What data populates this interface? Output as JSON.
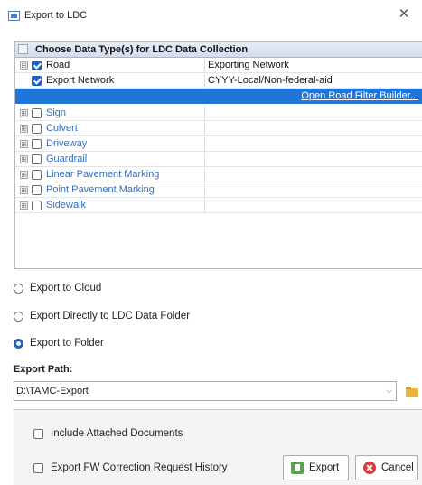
{
  "window": {
    "title": "Export to LDC",
    "close_glyph": "✕"
  },
  "tree": {
    "header": "Choose Data Type(s) for LDC Data Collection",
    "rows": [
      {
        "label": "Road",
        "value": "Exporting Network",
        "checked": true,
        "expander": "⊟"
      },
      {
        "label": "Export Network",
        "value": "CYYY-Local/Non-federal-aid",
        "checked": true
      },
      {
        "filter_link": "Open Road Filter Builder..."
      },
      {
        "label": "Sign",
        "checked": false,
        "expander": "⊞"
      },
      {
        "label": "Culvert",
        "checked": false,
        "expander": "⊞"
      },
      {
        "label": "Driveway",
        "checked": false,
        "expander": "⊞"
      },
      {
        "label": "Guardrail",
        "checked": false,
        "expander": "⊞"
      },
      {
        "label": "Linear Pavement Marking",
        "checked": false,
        "expander": "⊞"
      },
      {
        "label": "Point Pavement Marking",
        "checked": false,
        "expander": "⊞"
      },
      {
        "label": "Sidewalk",
        "checked": false,
        "expander": "⊞"
      }
    ]
  },
  "export_options": [
    {
      "label": "Export to Cloud",
      "selected": false
    },
    {
      "label": "Export Directly to LDC Data Folder",
      "selected": false
    },
    {
      "label": "Export to Folder",
      "selected": true
    }
  ],
  "export_path": {
    "label": "Export Path:",
    "value": "D:\\TAMC-Export"
  },
  "options": {
    "include_attached": "Include Attached Documents",
    "export_fw_history": "Export FW Correction Request History"
  },
  "buttons": {
    "export": "Export",
    "cancel": "Cancel"
  },
  "colors": {
    "selection": "#1f75d8",
    "link": "#2f6fc2",
    "checkbox_checked": "#1e5fc8"
  },
  "icons": {
    "app": "export-to-ldc-icon",
    "folder": "folder-icon",
    "export": "export-icon",
    "cancel": "cancel-icon"
  }
}
